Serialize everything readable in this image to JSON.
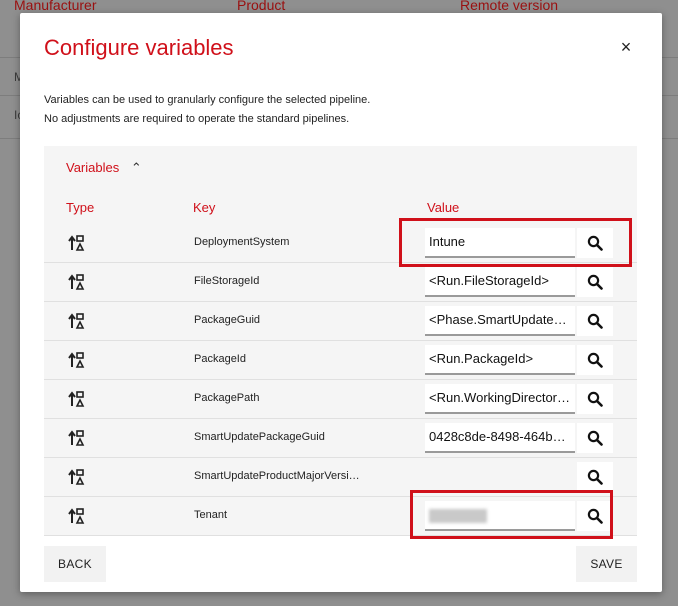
{
  "background": {
    "headers": [
      "Manufacturer",
      "Product",
      "Remote version"
    ],
    "row_fragments": [
      "M",
      "Ic"
    ]
  },
  "dialog": {
    "title": "Configure variables",
    "close_label": "×",
    "description_line1": "Variables can be used to granularly configure the selected pipeline.",
    "description_line2": "No adjustments are required to operate the standard pipelines.",
    "section_label": "Variables",
    "section_chevron": "⌃",
    "columns": {
      "type": "Type",
      "key": "Key",
      "value": "Value"
    },
    "rows": [
      {
        "key": "DeploymentSystem",
        "value": "Intune",
        "icon": "sort-variable-icon"
      },
      {
        "key": "FileStorageId",
        "value": "<Run.FileStorageId>",
        "icon": "sort-variable-icon"
      },
      {
        "key": "PackageGuid",
        "value": "<Phase.SmartUpdate…",
        "icon": "sort-variable-icon"
      },
      {
        "key": "PackageId",
        "value": "<Run.PackageId>",
        "icon": "sort-variable-icon"
      },
      {
        "key": "PackagePath",
        "value": "<Run.WorkingDirector…",
        "icon": "sort-variable-icon"
      },
      {
        "key": "SmartUpdatePackageGuid",
        "value": "0428c8de-8498-464b…",
        "icon": "sort-variable-icon"
      },
      {
        "key": "SmartUpdateProductMajorVersi…",
        "value": "",
        "icon": "sort-variable-icon"
      },
      {
        "key": "Tenant",
        "value": "",
        "icon": "sort-variable-icon"
      }
    ],
    "back_label": "BACK",
    "save_label": "SAVE",
    "accent_color": "#d0101a"
  }
}
